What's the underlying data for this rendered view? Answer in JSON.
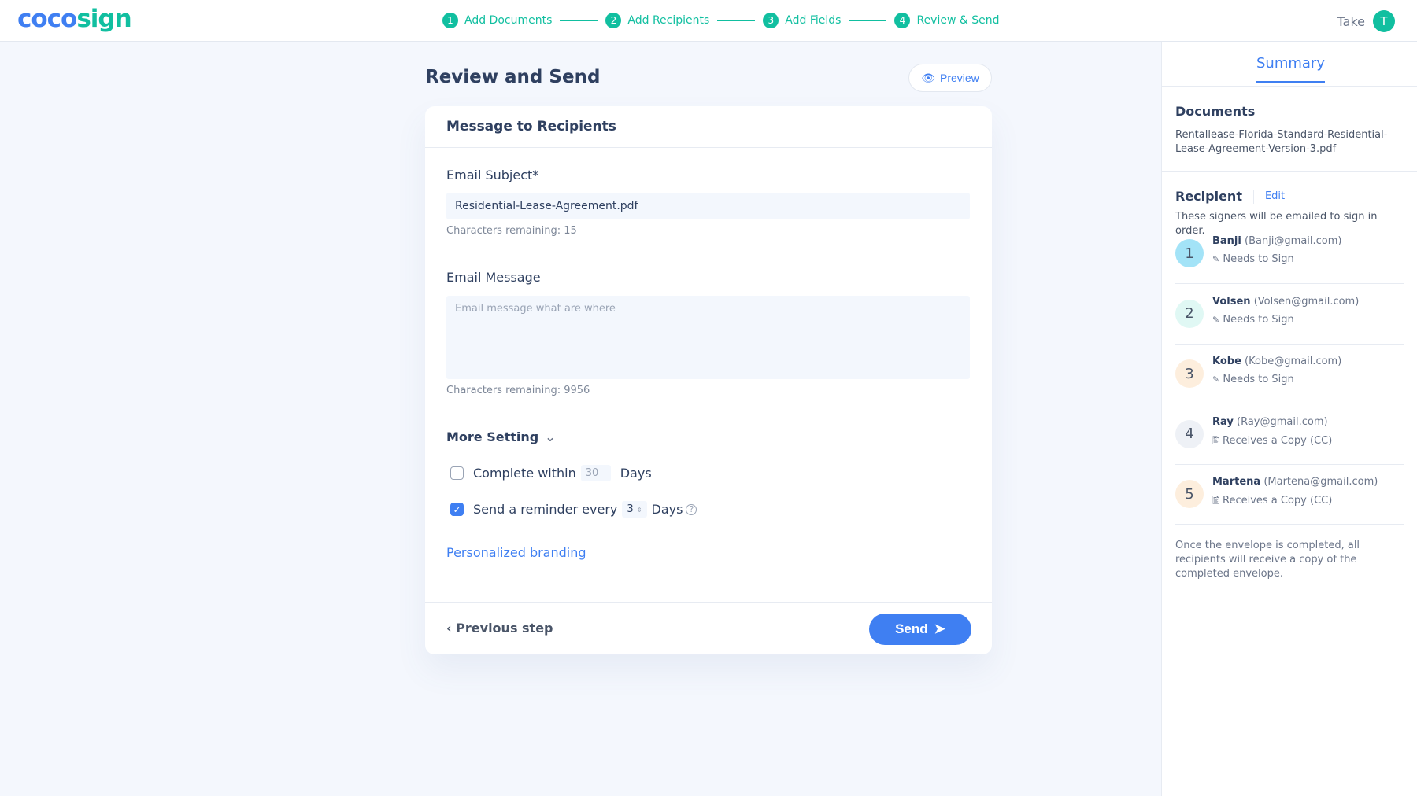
{
  "header": {
    "logo_a": "coco",
    "logo_b": "sign",
    "steps": [
      {
        "n": "1",
        "label": "Add Documents"
      },
      {
        "n": "2",
        "label": "Add Recipients"
      },
      {
        "n": "3",
        "label": "Add Fields"
      },
      {
        "n": "4",
        "label": "Review & Send"
      }
    ],
    "user_name": "Take",
    "avatar": "T"
  },
  "main": {
    "title": "Review and Send",
    "preview": "Preview",
    "card_title": "Message to Recipients",
    "subject_label": "Email Subject*",
    "subject_value": "Residential-Lease-Agreement.pdf",
    "subject_hint": "Characters remaining: 15",
    "message_label": "Email Message",
    "message_placeholder": "Email message what are where",
    "message_hint": "Characters remaining: 9956",
    "more_setting": "More Setting",
    "complete_label": "Complete within",
    "complete_value": "30",
    "complete_unit": "Days",
    "complete_checked": false,
    "reminder_label": "Send a reminder every",
    "reminder_value": "3",
    "reminder_unit": "Days",
    "reminder_checked": true,
    "branding": "Personalized branding",
    "previous": "Previous step",
    "send": "Send"
  },
  "summary": {
    "tab": "Summary",
    "documents_label": "Documents",
    "document": "Rentallease-Florida-Standard-Residential-Lease-Agreement-Version-3.pdf",
    "recipient_label": "Recipient",
    "edit": "Edit",
    "recipient_desc": "These signers will be emailed to sign in order.",
    "recipients": [
      {
        "n": "1",
        "name": "Banji",
        "email": "(Banji@gmail.com)",
        "role": "Needs to Sign",
        "color": "#a3e3f7"
      },
      {
        "n": "2",
        "name": "Volsen",
        "email": "(Volsen@gmail.com)",
        "role": "Needs to Sign",
        "color": "#e0f8f4"
      },
      {
        "n": "3",
        "name": "Kobe",
        "email": "(Kobe@gmail.com)",
        "role": "Needs to Sign",
        "color": "#fdeedd"
      },
      {
        "n": "4",
        "name": "Ray",
        "email": "(Ray@gmail.com)",
        "role": "Receives a Copy (CC)",
        "color": "#eef1f6"
      },
      {
        "n": "5",
        "name": "Martena",
        "email": "(Martena@gmail.com)",
        "role": "Receives a Copy (CC)",
        "color": "#fdeedd"
      }
    ],
    "footer": "Once the envelope is completed, all recipients will receive a copy of the completed envelope."
  }
}
